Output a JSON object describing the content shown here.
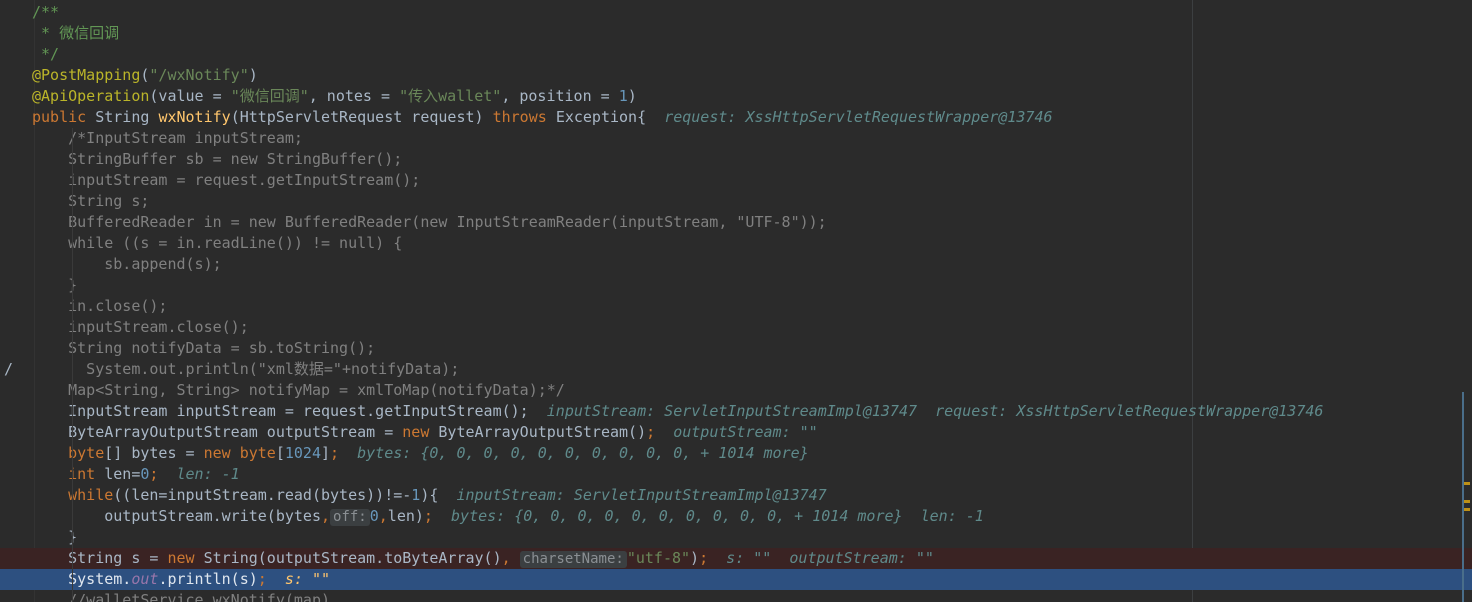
{
  "editor": {
    "lines": [
      [
        {
          "t": "/**",
          "c": "doc"
        }
      ],
      [
        {
          "t": " * 微信回调",
          "c": "doc"
        }
      ],
      [
        {
          "t": " */",
          "c": "doc"
        }
      ],
      [
        {
          "t": "@PostMapping",
          "c": "ann"
        },
        {
          "t": "(",
          "c": ""
        },
        {
          "t": "\"/wxNotify\"",
          "c": "str"
        },
        {
          "t": ")",
          "c": ""
        }
      ],
      [
        {
          "t": "@ApiOperation",
          "c": "ann"
        },
        {
          "t": "(value = ",
          "c": ""
        },
        {
          "t": "\"微信回调\"",
          "c": "str"
        },
        {
          "t": ", notes = ",
          "c": ""
        },
        {
          "t": "\"传入wallet\"",
          "c": "str"
        },
        {
          "t": ", position = ",
          "c": ""
        },
        {
          "t": "1",
          "c": "num"
        },
        {
          "t": ")",
          "c": ""
        }
      ],
      [
        {
          "t": "public ",
          "c": "kw"
        },
        {
          "t": "String ",
          "c": ""
        },
        {
          "t": "wxNotify",
          "c": "fn"
        },
        {
          "t": "(HttpServletRequest request) ",
          "c": ""
        },
        {
          "t": "throws ",
          "c": "kw"
        },
        {
          "t": "Exception{  ",
          "c": ""
        },
        {
          "t": "request: XssHttpServletRequestWrapper@13746",
          "c": "dbg"
        }
      ],
      [
        {
          "t": "    /*InputStream inputStream;",
          "c": "cm"
        }
      ],
      [
        {
          "t": "    StringBuffer sb = new StringBuffer();",
          "c": "cm"
        }
      ],
      [
        {
          "t": "    inputStream = request.getInputStream();",
          "c": "cm"
        }
      ],
      [
        {
          "t": "    String s;",
          "c": "cm"
        }
      ],
      [
        {
          "t": "    BufferedReader in = new BufferedReader(new InputStreamReader(inputStream, \"UTF-8\"));",
          "c": "cm"
        }
      ],
      [
        {
          "t": "    while ((s = in.readLine()) != null) {",
          "c": "cm"
        }
      ],
      [
        {
          "t": "        sb.append(s);",
          "c": "cm"
        }
      ],
      [
        {
          "t": "    }",
          "c": "cm"
        }
      ],
      [
        {
          "t": "    in.close();",
          "c": "cm"
        }
      ],
      [
        {
          "t": "    inputStream.close();",
          "c": "cm"
        }
      ],
      [
        {
          "t": "    String notifyData = sb.toString();",
          "c": "cm"
        }
      ],
      [
        {
          "t": "      System.out.println(\"xml数据=\"+notifyData);",
          "c": "cm"
        }
      ],
      [
        {
          "t": "    Map<String, String> notifyMap = xmlToMap(notifyData);*/",
          "c": "cm"
        }
      ],
      [
        {
          "t": "    InputStream inputStream = request.getInputStream();  ",
          "c": ""
        },
        {
          "t": "inputStream: ServletInputStreamImpl@13747  request: XssHttpServletRequestWrapper@13746",
          "c": "dbg"
        }
      ],
      [
        {
          "t": "    ByteArrayOutputStream outputStream = ",
          "c": ""
        },
        {
          "t": "new ",
          "c": "kw"
        },
        {
          "t": "ByteArrayOutputStream()",
          "c": ""
        },
        {
          "t": ";  ",
          "c": "kw"
        },
        {
          "t": "outputStream: \"\"",
          "c": "dbg"
        }
      ],
      [
        {
          "t": "    ",
          "c": ""
        },
        {
          "t": "byte",
          "c": "kw"
        },
        {
          "t": "[] bytes = ",
          "c": ""
        },
        {
          "t": "new byte",
          "c": "kw"
        },
        {
          "t": "[",
          "c": ""
        },
        {
          "t": "1024",
          "c": "num"
        },
        {
          "t": "]",
          "c": ""
        },
        {
          "t": ";  ",
          "c": "kw"
        },
        {
          "t": "bytes: {0, 0, 0, 0, 0, 0, 0, 0, 0, 0, + 1014 more}",
          "c": "dbg"
        }
      ],
      [
        {
          "t": "    ",
          "c": ""
        },
        {
          "t": "int ",
          "c": "kw"
        },
        {
          "t": "len=",
          "c": ""
        },
        {
          "t": "0",
          "c": "num"
        },
        {
          "t": ";  ",
          "c": "kw"
        },
        {
          "t": "len: -1",
          "c": "dbg"
        }
      ],
      [
        {
          "t": "    ",
          "c": ""
        },
        {
          "t": "while",
          "c": "kw"
        },
        {
          "t": "((len=inputStream.read(bytes))!=-",
          "c": ""
        },
        {
          "t": "1",
          "c": "num"
        },
        {
          "t": "){  ",
          "c": ""
        },
        {
          "t": "inputStream: ServletInputStreamImpl@13747",
          "c": "dbg"
        }
      ],
      [
        {
          "t": "        outputStream.write(bytes",
          "c": ""
        },
        {
          "t": ",",
          "c": "kw"
        },
        {
          "t": "off:",
          "c": "hint"
        },
        {
          "t": "0",
          "c": "num"
        },
        {
          "t": ",",
          "c": "kw"
        },
        {
          "t": "len)",
          "c": ""
        },
        {
          "t": ";  ",
          "c": "kw"
        },
        {
          "t": "bytes: {0, 0, 0, 0, 0, 0, 0, 0, 0, 0, + 1014 more}  len: -1",
          "c": "dbg"
        }
      ],
      [
        {
          "t": "    }",
          "c": ""
        }
      ],
      [
        {
          "t": "    String s = ",
          "c": ""
        },
        {
          "t": "new ",
          "c": "kw"
        },
        {
          "t": "String(outputStream.toByteArray()",
          "c": ""
        },
        {
          "t": ", ",
          "c": "kw"
        },
        {
          "t": "charsetName:",
          "c": "hint"
        },
        {
          "t": "\"utf-8\"",
          "c": "str"
        },
        {
          "t": ")",
          "c": ""
        },
        {
          "t": ";  ",
          "c": "kw"
        },
        {
          "t": "s: \"\"  outputStream: \"\"",
          "c": "dbg"
        }
      ],
      [
        {
          "t": "    System.",
          "c": ""
        },
        {
          "t": "out",
          "c": "field"
        },
        {
          "t": ".println(s)",
          "c": ""
        },
        {
          "t": ";  ",
          "c": "kw"
        },
        {
          "t": "s: \"\"",
          "c": "dbg"
        }
      ],
      [
        {
          "t": "    //walletService.wxNotify(map)",
          "c": "cm"
        }
      ]
    ]
  }
}
